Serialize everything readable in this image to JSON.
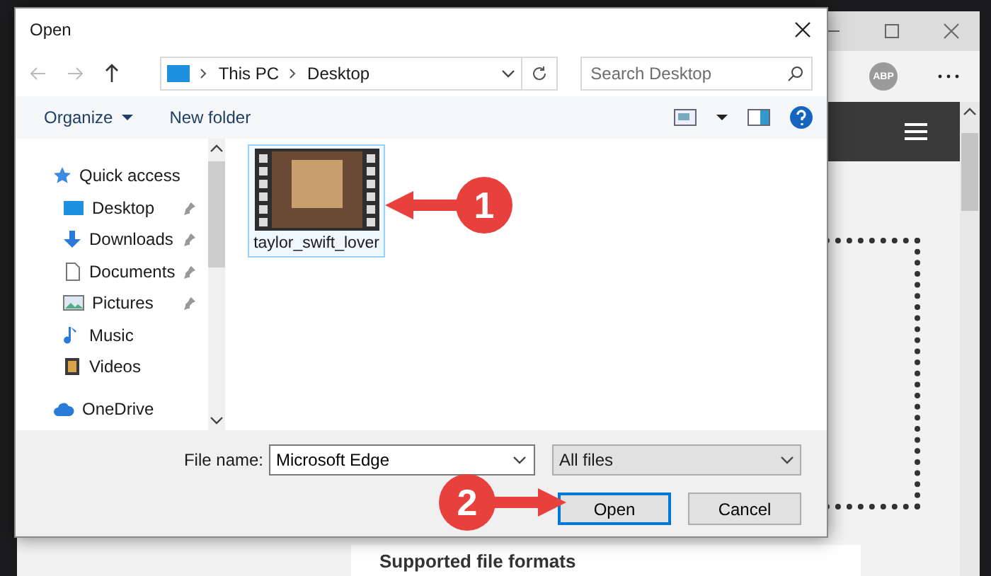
{
  "browser": {
    "badge": "ABP",
    "footer_label": "Supported file formats"
  },
  "dialog": {
    "title": "Open",
    "breadcrumbs": [
      {
        "label": "This PC"
      },
      {
        "label": "Desktop"
      }
    ],
    "search": {
      "placeholder": "Search Desktop"
    },
    "toolbar": [
      {
        "label": "Organize",
        "kind": "menu"
      },
      {
        "label": "New folder",
        "kind": "button"
      }
    ],
    "nav": [
      {
        "label": "Quick access",
        "kind": "star",
        "pinned": false,
        "children": [
          {
            "label": "Desktop",
            "kind": "desktop",
            "pinned": true
          },
          {
            "label": "Downloads",
            "kind": "download",
            "pinned": true
          },
          {
            "label": "Documents",
            "kind": "document",
            "pinned": true
          },
          {
            "label": "Pictures",
            "kind": "picture",
            "pinned": true
          },
          {
            "label": "Music",
            "kind": "music",
            "pinned": false
          },
          {
            "label": "Videos",
            "kind": "video",
            "pinned": false
          }
        ]
      },
      {
        "label": "OneDrive",
        "kind": "cloud",
        "pinned": false
      }
    ],
    "files": [
      {
        "name": "taylor_swift_lover",
        "selected": true
      }
    ],
    "file_name": {
      "label": "File name:",
      "value": "Microsoft Edge"
    },
    "file_type": {
      "value": "All files"
    },
    "buttons": [
      {
        "label": "Open",
        "kind": "primary"
      },
      {
        "label": "Cancel",
        "kind": "secondary"
      }
    ]
  },
  "annotations": [
    {
      "label": "1",
      "kind": "left"
    },
    {
      "label": "2",
      "kind": "right"
    }
  ]
}
